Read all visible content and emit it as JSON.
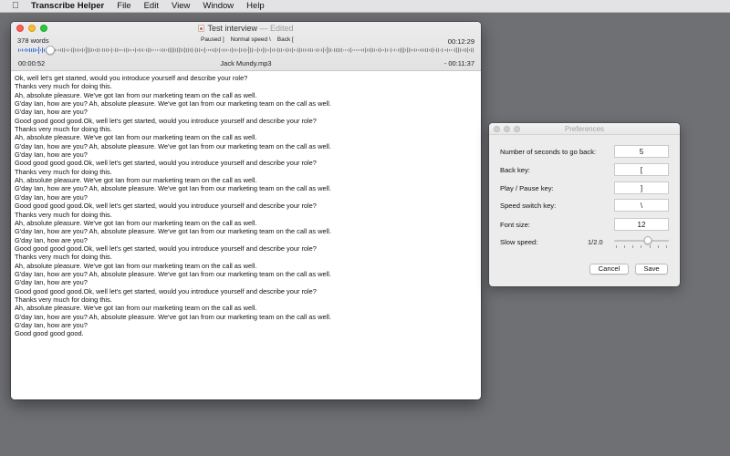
{
  "menubar": {
    "app_name": "Transcribe Helper",
    "items": [
      "File",
      "Edit",
      "View",
      "Window",
      "Help"
    ]
  },
  "main_window": {
    "title": "Test interview",
    "title_suffix": "— Edited",
    "word_count": "378 words",
    "status": {
      "paused": "Paused ]",
      "speed": "Normal speed \\",
      "back": "Back ["
    },
    "total_time": "00:12:29",
    "elapsed": "00:00:52",
    "filename": "Jack Mundy.mp3",
    "remaining": "- 00:11:37",
    "playback_progress": 0.07,
    "transcript_lines": [
      "Ok, well let's get started, would you introduce yourself and describe your role?",
      "Thanks very much for doing this.",
      "Ah, absolute pleasure. We've got Ian from our marketing team on the call as well.",
      "G'day Ian, how are you? Ah, absolute pleasure. We've got Ian from our marketing team on the call as well.",
      "G'day Ian, how are you?",
      "Good good good good.Ok, well let's get started, would you introduce yourself and describe your role?",
      "Thanks very much for doing this.",
      "Ah, absolute pleasure. We've got Ian from our marketing team on the call as well.",
      "G'day Ian, how are you? Ah, absolute pleasure. We've got Ian from our marketing team on the call as well.",
      "G'day Ian, how are you?",
      "Good good good good.Ok, well let's get started, would you introduce yourself and describe your role?",
      "Thanks very much for doing this.",
      "Ah, absolute pleasure. We've got Ian from our marketing team on the call as well.",
      "G'day Ian, how are you? Ah, absolute pleasure. We've got Ian from our marketing team on the call as well.",
      "G'day Ian, how are you?",
      "Good good good good.Ok, well let's get started, would you introduce yourself and describe your role?",
      "Thanks very much for doing this.",
      "Ah, absolute pleasure. We've got Ian from our marketing team on the call as well.",
      "G'day Ian, how are you? Ah, absolute pleasure. We've got Ian from our marketing team on the call as well.",
      "G'day Ian, how are you?",
      "Good good good good.Ok, well let's get started, would you introduce yourself and describe your role?",
      "Thanks very much for doing this.",
      "Ah, absolute pleasure. We've got Ian from our marketing team on the call as well.",
      "G'day Ian, how are you? Ah, absolute pleasure. We've got Ian from our marketing team on the call as well.",
      "G'day Ian, how are you?",
      "Good good good good.Ok, well let's get started, would you introduce yourself and describe your role?",
      "Thanks very much for doing this.",
      "Ah, absolute pleasure. We've got Ian from our marketing team on the call as well.",
      "G'day Ian, how are you? Ah, absolute pleasure. We've got Ian from our marketing team on the call as well.",
      "G'day Ian, how are you?",
      "Good good good good."
    ]
  },
  "preferences": {
    "title": "Preferences",
    "seconds_back_label": "Number of seconds to go back:",
    "seconds_back_value": "5",
    "back_key_label": "Back key:",
    "back_key_value": "[",
    "play_pause_label": "Play / Pause key:",
    "play_pause_value": "]",
    "speed_switch_label": "Speed switch key:",
    "speed_switch_value": "\\",
    "font_size_label": "Font size:",
    "font_size_value": "12",
    "slow_speed_label": "Slow speed:",
    "slow_speed_value": "1/2.0",
    "slow_speed_slider_fraction": 0.62,
    "cancel_label": "Cancel",
    "save_label": "Save"
  },
  "colors": {
    "desktop": "#6f7074",
    "waveform": "#3b6fd6",
    "waveform_unplayed": "#8a8a8a"
  },
  "icons": {
    "apple": "apple-logo-icon",
    "document": "document-icon"
  }
}
